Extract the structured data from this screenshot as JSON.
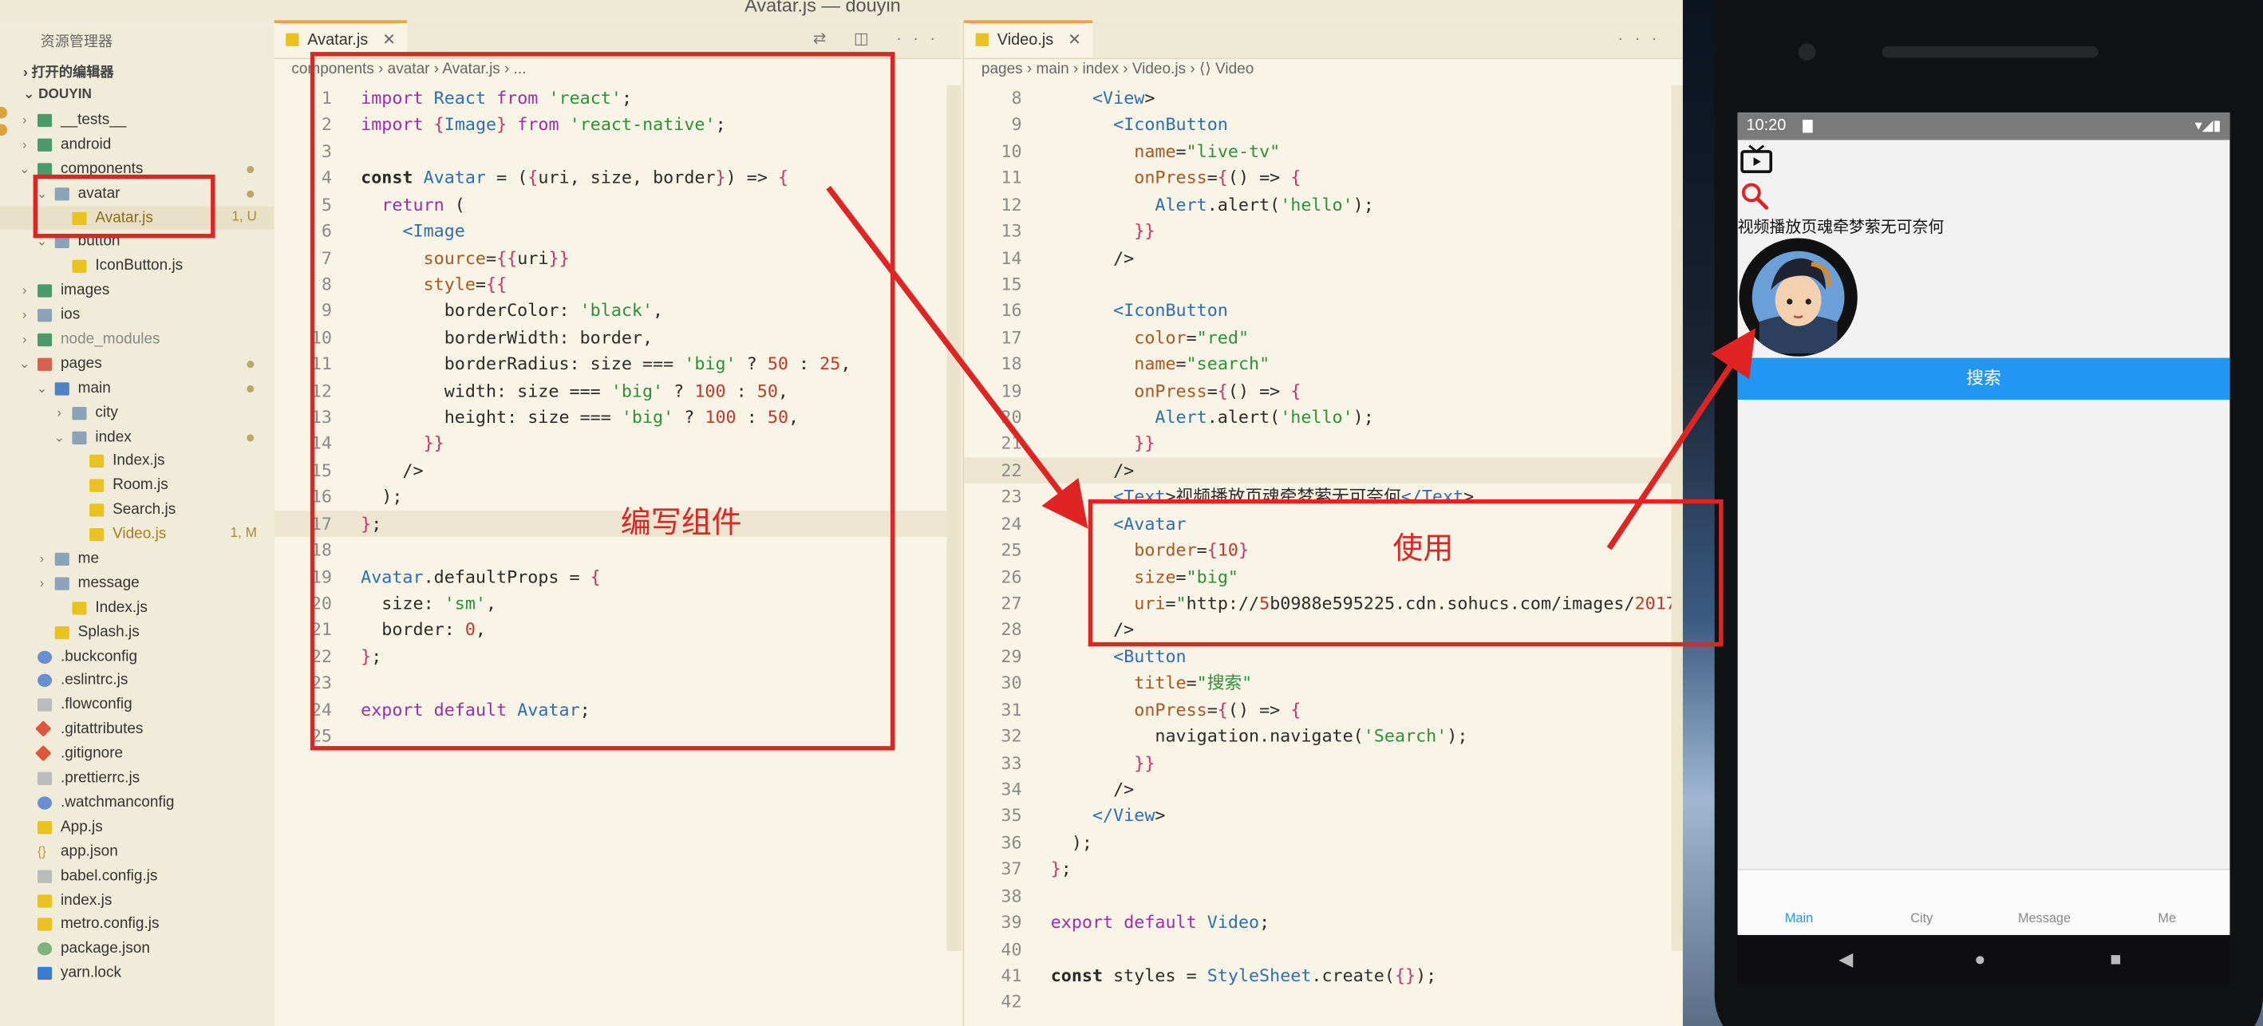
{
  "window": {
    "title": "Avatar.js — douyin"
  },
  "sidebar": {
    "header": "资源管理器",
    "open_editors": "打开的编辑器",
    "project": "DOUYIN",
    "tree": [
      {
        "label": "__tests__",
        "depth": 1,
        "type": "folder",
        "color": "g",
        "chev": "›"
      },
      {
        "label": "android",
        "depth": 1,
        "type": "folder",
        "color": "g",
        "chev": "›"
      },
      {
        "label": "components",
        "depth": 1,
        "type": "folder",
        "color": "g",
        "chev": "⌄",
        "dot": true
      },
      {
        "label": "avatar",
        "depth": 2,
        "type": "folder",
        "color": "",
        "chev": "⌄",
        "dot": true
      },
      {
        "label": "Avatar.js",
        "depth": 3,
        "type": "js",
        "badge": "1, U",
        "selected": true
      },
      {
        "label": "button",
        "depth": 2,
        "type": "folder",
        "color": "",
        "chev": "⌄"
      },
      {
        "label": "IconButton.js",
        "depth": 3,
        "type": "js"
      },
      {
        "label": "images",
        "depth": 1,
        "type": "folder",
        "color": "g",
        "chev": "›"
      },
      {
        "label": "ios",
        "depth": 1,
        "type": "folder",
        "color": "",
        "chev": "›"
      },
      {
        "label": "node_modules",
        "depth": 1,
        "type": "folder",
        "color": "g",
        "chev": "›",
        "muted": true
      },
      {
        "label": "pages",
        "depth": 1,
        "type": "folder",
        "color": "r",
        "chev": "⌄",
        "dot": true
      },
      {
        "label": "main",
        "depth": 2,
        "type": "folder",
        "color": "b",
        "chev": "⌄",
        "dot": true
      },
      {
        "label": "city",
        "depth": 3,
        "type": "folder",
        "color": "",
        "chev": "›"
      },
      {
        "label": "index",
        "depth": 3,
        "type": "folder",
        "color": "",
        "chev": "⌄",
        "dot": true
      },
      {
        "label": "Index.js",
        "depth": 4,
        "type": "js"
      },
      {
        "label": "Room.js",
        "depth": 4,
        "type": "js"
      },
      {
        "label": "Search.js",
        "depth": 4,
        "type": "js"
      },
      {
        "label": "Video.js",
        "depth": 4,
        "type": "js",
        "badge": "1, M",
        "mod": true
      },
      {
        "label": "me",
        "depth": 2,
        "type": "folder",
        "color": "",
        "chev": "›"
      },
      {
        "label": "message",
        "depth": 2,
        "type": "folder",
        "color": "",
        "chev": "›"
      },
      {
        "label": "Index.js",
        "depth": 3,
        "type": "js"
      },
      {
        "label": "Splash.js",
        "depth": 2,
        "type": "js"
      },
      {
        "label": ".buckconfig",
        "depth": 1,
        "type": "cfg"
      },
      {
        "label": ".eslintrc.js",
        "depth": 1,
        "type": "cfg"
      },
      {
        "label": ".flowconfig",
        "depth": 1,
        "type": "plain"
      },
      {
        "label": ".gitattributes",
        "depth": 1,
        "type": "git"
      },
      {
        "label": ".gitignore",
        "depth": 1,
        "type": "git"
      },
      {
        "label": ".prettierrc.js",
        "depth": 1,
        "type": "plain"
      },
      {
        "label": ".watchmanconfig",
        "depth": 1,
        "type": "cfg"
      },
      {
        "label": "App.js",
        "depth": 1,
        "type": "js"
      },
      {
        "label": "app.json",
        "depth": 1,
        "type": "json"
      },
      {
        "label": "babel.config.js",
        "depth": 1,
        "type": "plain"
      },
      {
        "label": "index.js",
        "depth": 1,
        "type": "js"
      },
      {
        "label": "metro.config.js",
        "depth": 1,
        "type": "js"
      },
      {
        "label": "package.json",
        "depth": 1,
        "type": "pkg"
      },
      {
        "label": "yarn.lock",
        "depth": 1,
        "type": "lock"
      }
    ]
  },
  "editor1": {
    "tab": "Avatar.js",
    "breadcrumb": "components › avatar › Avatar.js › ...",
    "lines": [
      "import React from 'react';",
      "import {Image} from 'react-native';",
      "",
      "const Avatar = ({uri, size, border}) => {",
      "  return (",
      "    <Image",
      "      source={{uri}}",
      "      style={{",
      "        borderColor: 'black',",
      "        borderWidth: border,",
      "        borderRadius: size === 'big' ? 50 : 25,",
      "        width: size === 'big' ? 100 : 50,",
      "        height: size === 'big' ? 100 : 50,",
      "      }}",
      "    />",
      "  );",
      "};",
      "",
      "Avatar.defaultProps = {",
      "  size: 'sm',",
      "  border: 0,",
      "};",
      "",
      "export default Avatar;",
      ""
    ],
    "annotation": "编写组件"
  },
  "editor2": {
    "tab": "Video.js",
    "breadcrumb": "pages › main › index › Video.js › ⟨⟩ Video",
    "first_line": 8,
    "lines": [
      "    <View>",
      "      <IconButton",
      "        name=\"live-tv\"",
      "        onPress={() => {",
      "          Alert.alert('hello');",
      "        }}",
      "      />",
      "",
      "      <IconButton",
      "        color=\"red\"",
      "        name=\"search\"",
      "        onPress={() => {",
      "          Alert.alert('hello');",
      "        }}",
      "      />",
      "      <Text>视频播放页魂牵梦萦无可奈何</Text>",
      "      <Avatar",
      "        border={10}",
      "        size=\"big\"",
      "        uri=\"http://5b0988e595225.cdn.sohucs.com/images/2017",
      "      />",
      "      <Button",
      "        title=\"搜索\"",
      "        onPress={() => {",
      "          navigation.navigate('Search');",
      "        }}",
      "      />",
      "    </View>",
      "  );",
      "};",
      "",
      "export default Video;",
      "",
      "const styles = StyleSheet.create({});",
      ""
    ],
    "annotation": "使用"
  },
  "phone": {
    "time": "10:20",
    "page_text": "视频播放页魂牵梦萦无可奈何",
    "search_button": "搜索",
    "tabs": [
      "Main",
      "City",
      "Message",
      "Me"
    ],
    "active_tab": "Main",
    "accent": "#2196f3",
    "icons": [
      "live-tv-icon",
      "search-icon"
    ]
  },
  "colors": {
    "annotation_red": "#e02424",
    "search_icon_red": "#e02424"
  }
}
